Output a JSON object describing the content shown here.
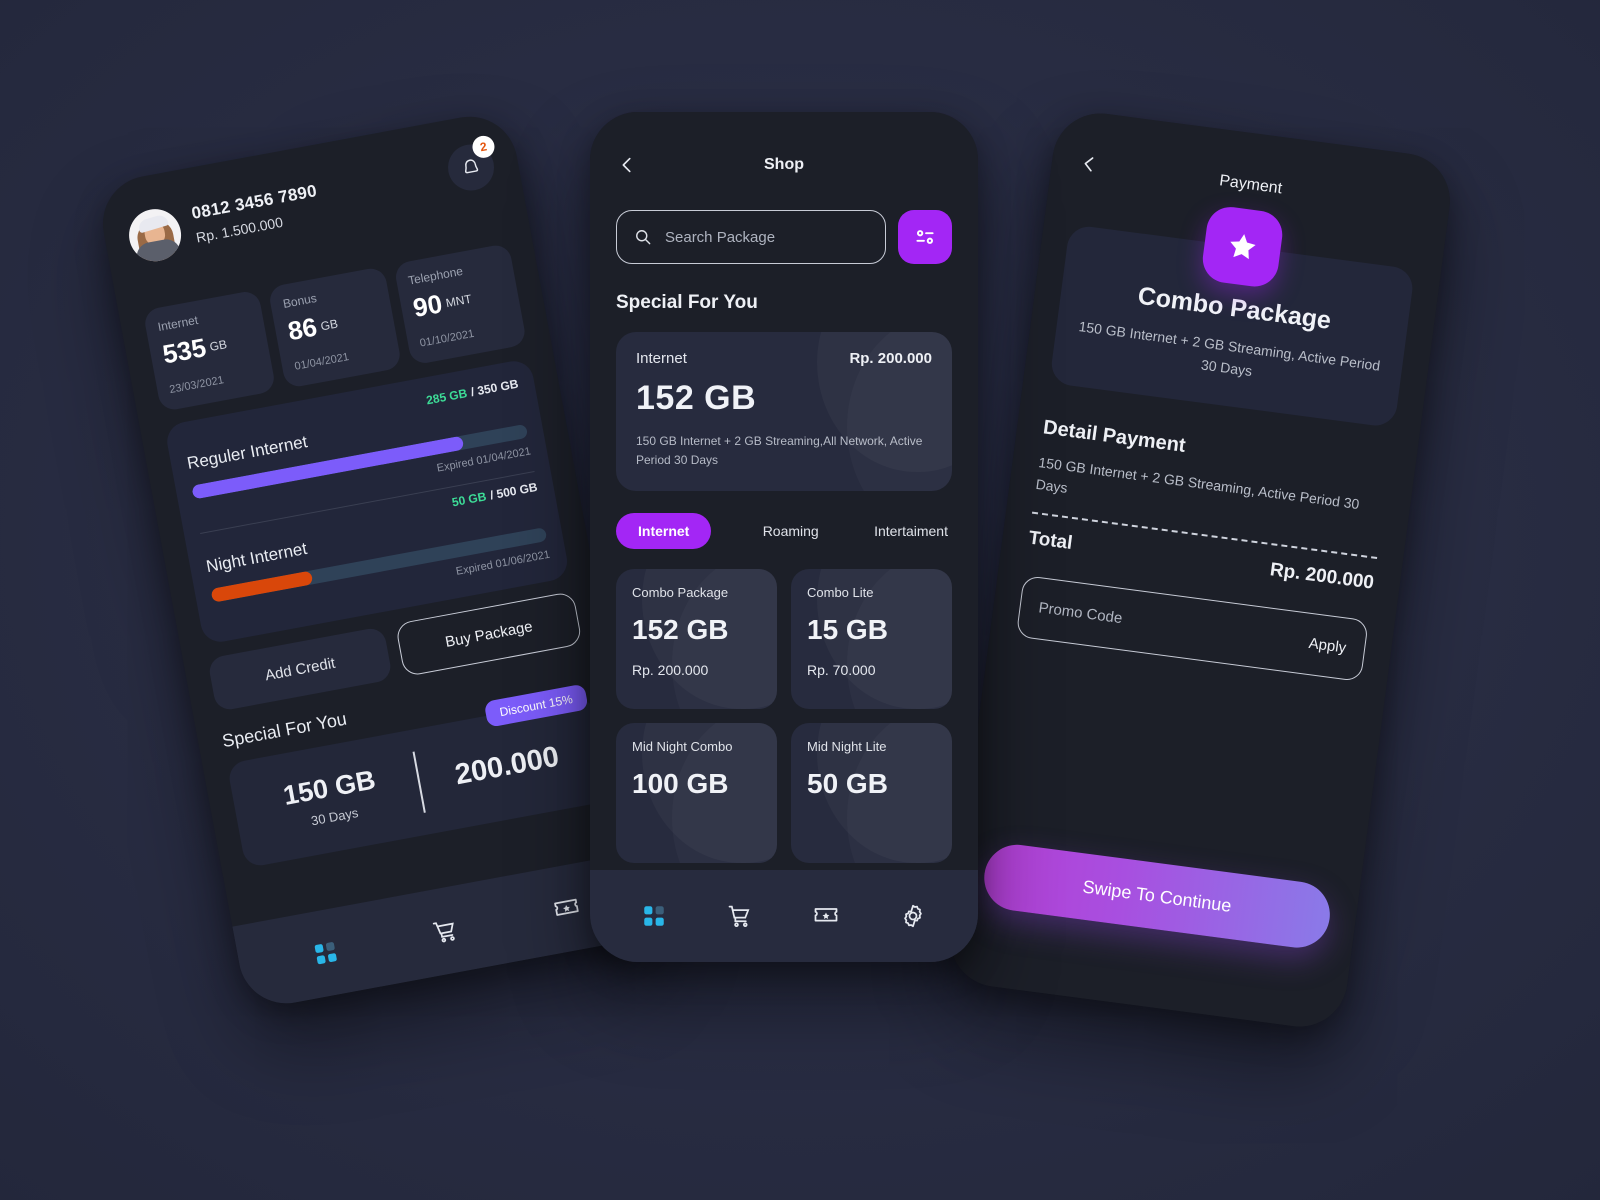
{
  "home": {
    "user": {
      "phone_number": "0812 3456 7890",
      "balance": "Rp. 1.500.000",
      "avatar_icon": "user-avatar-photo"
    },
    "notification": {
      "icon": "bell-icon",
      "badge_count": "2"
    },
    "stats": [
      {
        "label": "Internet",
        "value": "535",
        "unit": "GB",
        "date": "23/03/2021"
      },
      {
        "label": "Bonus",
        "value": "86",
        "unit": "GB",
        "date": "01/04/2021"
      },
      {
        "label": "Telephone",
        "value": "90",
        "unit": "MNT",
        "date": "01/10/2021"
      }
    ],
    "usage": [
      {
        "name": "Reguler Internet",
        "used": "285 GB",
        "total": "/ 350 GB",
        "expired": "Expired 01/04/2021",
        "percent": 81
      },
      {
        "name": "Night Internet",
        "used": "50 GB",
        "total": "/ 500 GB",
        "expired": "Expired 01/06/2021",
        "percent": 30
      }
    ],
    "actions": {
      "add_credit": "Add Credit",
      "buy_package": "Buy Package"
    },
    "special_title": "Special For You",
    "offer": {
      "discount_tag": "Discount 15%",
      "size": "150 GB",
      "days": "30 Days",
      "price": "200.000"
    },
    "nav": [
      {
        "icon": "grid-dashboard-icon",
        "active": true
      },
      {
        "icon": "cart-icon",
        "active": false
      },
      {
        "icon": "ticket-star-icon",
        "active": false
      }
    ]
  },
  "shop": {
    "back_icon": "chevron-left-icon",
    "title": "Shop",
    "search": {
      "icon": "search-icon",
      "placeholder": "Search Package",
      "value": ""
    },
    "filter_icon": "filter-sliders-icon",
    "section_title": "Special For You",
    "featured": {
      "label": "Internet",
      "price": "Rp. 200.000",
      "size": "152 GB",
      "description": "150 GB Internet + 2 GB Streaming,All Network, Active Period 30 Days"
    },
    "tabs": [
      {
        "label": "Internet",
        "active": true
      },
      {
        "label": "Roaming",
        "active": false
      },
      {
        "label": "Intertaiment",
        "active": false
      }
    ],
    "packages": [
      {
        "name": "Combo Package",
        "size": "152 GB",
        "price": "Rp. 200.000"
      },
      {
        "name": "Combo Lite",
        "size": "15 GB",
        "price": "Rp. 70.000"
      },
      {
        "name": "Mid Night Combo",
        "size": "100 GB",
        "price": ""
      },
      {
        "name": "Mid Night Lite",
        "size": "50 GB",
        "price": ""
      }
    ],
    "nav": [
      {
        "icon": "grid-dashboard-icon",
        "active": true
      },
      {
        "icon": "cart-icon",
        "active": false
      },
      {
        "icon": "ticket-star-icon",
        "active": false
      },
      {
        "icon": "gear-icon",
        "active": false
      }
    ]
  },
  "payment": {
    "back_icon": "chevron-left-icon",
    "title": "Payment",
    "hero": {
      "badge_icon": "star-icon",
      "name": "Combo Package",
      "description": "150 GB Internet + 2 GB Streaming, Active Period 30 Days"
    },
    "detail_title": "Detail Payment",
    "detail_description": "150 GB Internet + 2 GB Streaming, Active Period 30 Days",
    "total_label": "Total",
    "total_value": "Rp. 200.000",
    "promo": {
      "placeholder": "Promo Code",
      "value": "",
      "apply_label": "Apply"
    },
    "swipe_label": "Swipe To Continue"
  },
  "colors": {
    "background": "#2a2e45",
    "phone_body": "#1c1f28",
    "card": "#262a3c",
    "accent_purple": "#a326f5",
    "progress_purple": "#7c5cfa",
    "progress_orange": "#d9470a",
    "success_green": "#3ddc97",
    "badge_orange": "#e4540d",
    "nav_active_blue": "#29b6e8"
  }
}
